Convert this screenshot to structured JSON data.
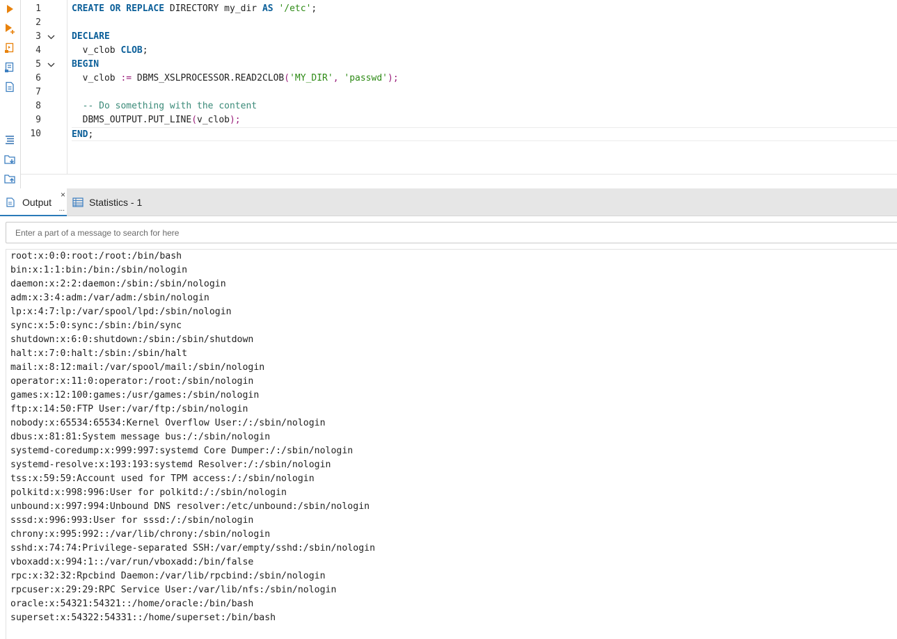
{
  "toolbar": {
    "buttons": [
      "execute-statement-icon",
      "execute-script-icon",
      "explain-plan-icon",
      "export-data-icon",
      "load-script-icon",
      "format-sql-icon",
      "save-to-folder-icon",
      "open-from-folder-icon"
    ]
  },
  "editor": {
    "lines": [
      {
        "num": "1",
        "tokens": [
          {
            "t": "CREATE",
            "c": "kw"
          },
          {
            "t": " "
          },
          {
            "t": "OR",
            "c": "kw"
          },
          {
            "t": " "
          },
          {
            "t": "REPLACE",
            "c": "kw"
          },
          {
            "t": " DIRECTORY my_dir "
          },
          {
            "t": "AS",
            "c": "kw"
          },
          {
            "t": " "
          },
          {
            "t": "'/etc'",
            "c": "str"
          },
          {
            "t": ";"
          }
        ]
      },
      {
        "num": "2",
        "tokens": []
      },
      {
        "num": "3",
        "fold": true,
        "tokens": [
          {
            "t": "DECLARE",
            "c": "kw"
          }
        ]
      },
      {
        "num": "4",
        "tokens": [
          {
            "t": "  v_clob "
          },
          {
            "t": "CLOB",
            "c": "kw"
          },
          {
            "t": ";"
          }
        ]
      },
      {
        "num": "5",
        "fold": true,
        "tokens": [
          {
            "t": "BEGIN",
            "c": "kw"
          }
        ]
      },
      {
        "num": "6",
        "tokens": [
          {
            "t": "  v_clob "
          },
          {
            "t": ":=",
            "c": "op"
          },
          {
            "t": " DBMS_XSLPROCESSOR.READ2CLOB"
          },
          {
            "t": "(",
            "c": "op"
          },
          {
            "t": "'MY_DIR'",
            "c": "str"
          },
          {
            "t": ", ",
            "c": "op"
          },
          {
            "t": "'passwd'",
            "c": "str"
          },
          {
            "t": ");",
            "c": "op"
          }
        ]
      },
      {
        "num": "7",
        "tokens": []
      },
      {
        "num": "8",
        "tokens": [
          {
            "t": "  "
          },
          {
            "t": "-- Do something with the content",
            "c": "cmt"
          }
        ]
      },
      {
        "num": "9",
        "tokens": [
          {
            "t": "  DBMS_OUTPUT.PUT_LINE"
          },
          {
            "t": "(",
            "c": "op"
          },
          {
            "t": "v_clob"
          },
          {
            "t": ");",
            "c": "op"
          }
        ]
      },
      {
        "num": "10",
        "current": true,
        "tokens": [
          {
            "t": "END",
            "c": "kw"
          },
          {
            "t": ";"
          }
        ]
      }
    ]
  },
  "tabs": {
    "output_label": "Output",
    "output_close": "×",
    "output_more": "...",
    "statistics_label": "Statistics - 1"
  },
  "search": {
    "placeholder": "Enter a part of a message to search for here"
  },
  "output": {
    "lines": [
      "root:x:0:0:root:/root:/bin/bash",
      "bin:x:1:1:bin:/bin:/sbin/nologin",
      "daemon:x:2:2:daemon:/sbin:/sbin/nologin",
      "adm:x:3:4:adm:/var/adm:/sbin/nologin",
      "lp:x:4:7:lp:/var/spool/lpd:/sbin/nologin",
      "sync:x:5:0:sync:/sbin:/bin/sync",
      "shutdown:x:6:0:shutdown:/sbin:/sbin/shutdown",
      "halt:x:7:0:halt:/sbin:/sbin/halt",
      "mail:x:8:12:mail:/var/spool/mail:/sbin/nologin",
      "operator:x:11:0:operator:/root:/sbin/nologin",
      "games:x:12:100:games:/usr/games:/sbin/nologin",
      "ftp:x:14:50:FTP User:/var/ftp:/sbin/nologin",
      "nobody:x:65534:65534:Kernel Overflow User:/:/sbin/nologin",
      "dbus:x:81:81:System message bus:/:/sbin/nologin",
      "systemd-coredump:x:999:997:systemd Core Dumper:/:/sbin/nologin",
      "systemd-resolve:x:193:193:systemd Resolver:/:/sbin/nologin",
      "tss:x:59:59:Account used for TPM access:/:/sbin/nologin",
      "polkitd:x:998:996:User for polkitd:/:/sbin/nologin",
      "unbound:x:997:994:Unbound DNS resolver:/etc/unbound:/sbin/nologin",
      "sssd:x:996:993:User for sssd:/:/sbin/nologin",
      "chrony:x:995:992::/var/lib/chrony:/sbin/nologin",
      "sshd:x:74:74:Privilege-separated SSH:/var/empty/sshd:/sbin/nologin",
      "vboxadd:x:994:1::/var/run/vboxadd:/bin/false",
      "rpc:x:32:32:Rpcbind Daemon:/var/lib/rpcbind:/sbin/nologin",
      "rpcuser:x:29:29:RPC Service User:/var/lib/nfs:/sbin/nologin",
      "oracle:x:54321:54321::/home/oracle:/bin/bash",
      "superset:x:54322:54331::/home/superset:/bin/bash"
    ]
  }
}
